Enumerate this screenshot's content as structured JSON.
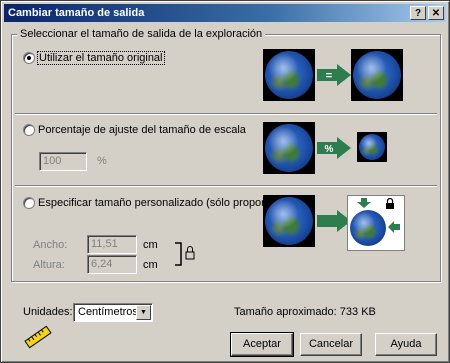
{
  "window": {
    "title": "Cambiar tamaño de salida",
    "help_button": "?",
    "close_button": "✕"
  },
  "group": {
    "label": "Seleccionar el tamaño de salida de la exploración"
  },
  "options": {
    "original": {
      "label": "Utilizar el tamaño original",
      "selected": true
    },
    "scale": {
      "label": "Porcentaje de ajuste del tamaño de escala",
      "selected": false,
      "value": "100",
      "unit": "%"
    },
    "custom": {
      "label": "Especificar tamaño personalizado (sólo proporcional)",
      "selected": false
    }
  },
  "custom_fields": {
    "width_label": "Ancho:",
    "width_value": "11,51",
    "width_unit": "cm",
    "height_label": "Altura:",
    "height_value": "6,24",
    "height_unit": "cm"
  },
  "arrow_symbols": {
    "equal": "=",
    "percent": "%"
  },
  "units": {
    "label": "Unidades:",
    "selected": "Centímetros"
  },
  "approx_size": "Tamaño aproximado: 733 KB",
  "buttons": {
    "accept": "Aceptar",
    "cancel": "Cancelar",
    "help": "Ayuda"
  },
  "colors": {
    "arrow_green": "#2e7d4f",
    "title_blue": "#0a246a"
  }
}
